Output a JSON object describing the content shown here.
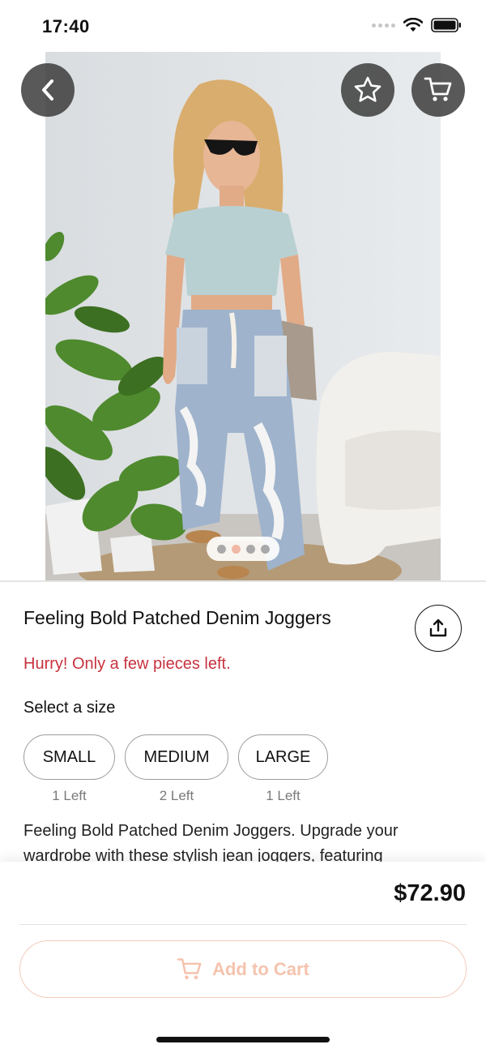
{
  "status_bar": {
    "time": "17:40"
  },
  "product": {
    "title": "Feeling Bold Patched Denim Joggers",
    "stock_warning": "Hurry! Only a few pieces left.",
    "size_heading": "Select a size",
    "sizes": [
      {
        "label": "SMALL",
        "stock": "1 Left"
      },
      {
        "label": "MEDIUM",
        "stock": "2 Left"
      },
      {
        "label": "LARGE",
        "stock": "1 Left"
      }
    ],
    "description": "Feeling Bold Patched Denim Joggers. Upgrade your wardrobe with these stylish jean joggers, featuring",
    "price": "$72.90"
  },
  "gallery": {
    "page_count": 4,
    "active_index": 1
  },
  "actions": {
    "add_to_cart_label": "Add to Cart"
  },
  "icons": {
    "back": "chevron-left-icon",
    "favorite": "star-icon",
    "cart": "cart-icon",
    "share": "share-icon"
  },
  "colors": {
    "warning": "#c8323e",
    "accent": "#f5c3ae",
    "pager_active": "#f0b8a6",
    "float_button": "#3c3c3c"
  }
}
